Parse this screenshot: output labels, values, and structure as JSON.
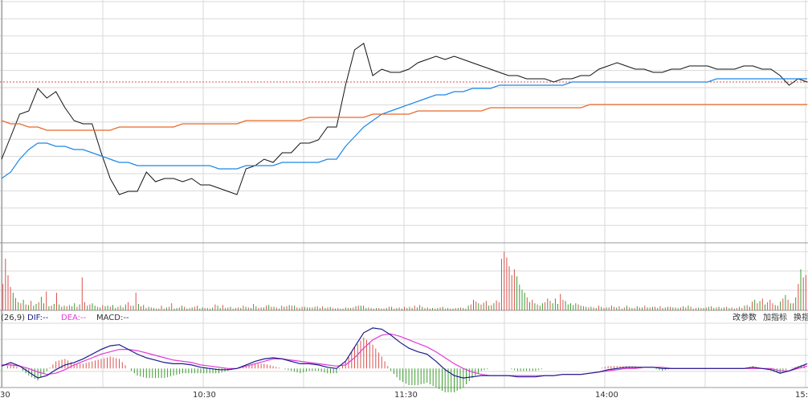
{
  "chart_data": [
    {
      "type": "line",
      "panel": "intraday-price",
      "grid": true,
      "series": [
        {
          "color": "#111111",
          "values": [
            126,
            133,
            140,
            141,
            148,
            145,
            147,
            142,
            138,
            137,
            137,
            128,
            120,
            115,
            116,
            116,
            122,
            119,
            120,
            120,
            119,
            120,
            118,
            118,
            117,
            116,
            115,
            123,
            124,
            126,
            125,
            128,
            128,
            131,
            131,
            132,
            136,
            136,
            149,
            160,
            162,
            152,
            154,
            153,
            153,
            154,
            156,
            157,
            158,
            157,
            158,
            157,
            156,
            155,
            154,
            153,
            152,
            152,
            151,
            151,
            151,
            150,
            151,
            151,
            152,
            152,
            154,
            155,
            156,
            155,
            154,
            154,
            153,
            153,
            154,
            154,
            155,
            155,
            155,
            154,
            154,
            154,
            155,
            155,
            154,
            154,
            152,
            149,
            151,
            150
          ]
        },
        {
          "color": "#1e88e5",
          "values": [
            120,
            122,
            126,
            129,
            131,
            131,
            130,
            130,
            129,
            129,
            128,
            127,
            126,
            125,
            125,
            124,
            124,
            124,
            124,
            124,
            124,
            124,
            124,
            124,
            123,
            123,
            123,
            124,
            124,
            124,
            124,
            125,
            125,
            125,
            125,
            125,
            126,
            126,
            130,
            133,
            136,
            138,
            140,
            141,
            142,
            143,
            144,
            145,
            146,
            146,
            147,
            147,
            148,
            148,
            148,
            149,
            149,
            149,
            149,
            149,
            149,
            149,
            149,
            150,
            150,
            150,
            150,
            150,
            150,
            150,
            150,
            150,
            150,
            150,
            150,
            150,
            150,
            150,
            150,
            151,
            151,
            151,
            151,
            151,
            151,
            151,
            151,
            151,
            151,
            151
          ]
        },
        {
          "color": "#e8692a",
          "values": [
            138,
            137,
            137,
            136,
            136,
            135,
            135,
            135,
            135,
            135,
            135,
            135,
            135,
            136,
            136,
            136,
            136,
            136,
            136,
            136,
            137,
            137,
            137,
            137,
            137,
            137,
            137,
            138,
            138,
            138,
            138,
            138,
            138,
            138,
            139,
            139,
            139,
            139,
            139,
            139,
            139,
            140,
            140,
            140,
            140,
            140,
            141,
            141,
            141,
            141,
            141,
            141,
            141,
            141,
            142,
            142,
            142,
            142,
            142,
            142,
            142,
            142,
            142,
            142,
            142,
            143,
            143,
            143,
            143,
            143,
            143,
            143,
            143,
            143,
            143,
            143,
            143,
            143,
            143,
            143,
            143,
            143,
            143,
            143,
            143,
            143,
            143,
            143,
            143,
            143
          ]
        }
      ],
      "reference_level": 150,
      "reference_color": "#d9534f"
    },
    {
      "type": "bar",
      "panel": "volume",
      "grid": true,
      "up_color": "#d9534f",
      "down_color": "#3d9c2f",
      "values": [
        45,
        88,
        60,
        40,
        30,
        21,
        14,
        12,
        18,
        10,
        9,
        16,
        8,
        11,
        14,
        23,
        12,
        32,
        7,
        8,
        11,
        30,
        10,
        6,
        8,
        7,
        9,
        7,
        12,
        6,
        10,
        56,
        14,
        8,
        10,
        12,
        8,
        6,
        5,
        9,
        7,
        8,
        6,
        9,
        4,
        6,
        8,
        5,
        10,
        14,
        8,
        8,
        30,
        11,
        7,
        9,
        4,
        6,
        5,
        4,
        3,
        3,
        8,
        3,
        5,
        6,
        12,
        3,
        4,
        5,
        8,
        6,
        3,
        4,
        5,
        6,
        8,
        3,
        5,
        4,
        4,
        3,
        5,
        10,
        8,
        4,
        9,
        4,
        5,
        6,
        3,
        4,
        5,
        4,
        8,
        6,
        5,
        4,
        11,
        7,
        4,
        5,
        5,
        8,
        9,
        6,
        6,
        5,
        3,
        8,
        6,
        7,
        9,
        8,
        8,
        5,
        4,
        6,
        6,
        5,
        5,
        5,
        6,
        7,
        4,
        7,
        4,
        5,
        6,
        4,
        3,
        4,
        3,
        3,
        5,
        4,
        4,
        5,
        7,
        8,
        8,
        8,
        4,
        5,
        4,
        3,
        4,
        4,
        3,
        3,
        4,
        6,
        6,
        3,
        4,
        5,
        3,
        6,
        4,
        6,
        4,
        8,
        5,
        9,
        6,
        4,
        5,
        3,
        4,
        3,
        4,
        5,
        6,
        3,
        4,
        3,
        3,
        4,
        4,
        5,
        4,
        3,
        8,
        10,
        18,
        15,
        12,
        10,
        13,
        16,
        8,
        9,
        12,
        17,
        14,
        88,
        100,
        90,
        75,
        60,
        70,
        58,
        44,
        35,
        30,
        22,
        14,
        18,
        12,
        10,
        8,
        12,
        14,
        20,
        16,
        12,
        20,
        11,
        28,
        18,
        16,
        10,
        12,
        9,
        12,
        10,
        8,
        7,
        6,
        5,
        6,
        5,
        4,
        8,
        6,
        4,
        5,
        5,
        8,
        6,
        5,
        7,
        3,
        5,
        8,
        5,
        4,
        4,
        7,
        5,
        5,
        8,
        5,
        5,
        6,
        6,
        4,
        7,
        4,
        5,
        6,
        6,
        5,
        5,
        4,
        5,
        7,
        5,
        8,
        6,
        3,
        4,
        5,
        4,
        4,
        5,
        6,
        7,
        4,
        5,
        6,
        4,
        5,
        6,
        4,
        5,
        3,
        4,
        6,
        4,
        8,
        9,
        6,
        15,
        18,
        12,
        16,
        20,
        10,
        14,
        18,
        12,
        9,
        8,
        15,
        20,
        26,
        18,
        12,
        12,
        22,
        45,
        70,
        56,
        60
      ],
      "up": [
        1,
        1,
        1,
        1,
        0,
        1,
        0,
        1,
        0,
        1,
        0,
        1,
        0,
        0,
        1,
        0,
        0,
        1,
        0,
        1,
        0,
        1,
        0,
        1,
        0,
        1,
        1,
        0,
        0,
        1,
        0,
        1,
        1,
        0,
        1,
        0,
        0,
        1,
        0,
        1,
        0,
        0,
        1,
        0,
        0,
        1,
        0,
        1,
        0,
        1,
        1,
        0,
        1,
        0,
        1,
        0,
        1,
        0,
        1,
        0,
        1,
        0,
        1,
        1,
        0,
        1,
        1,
        0,
        0,
        1,
        0,
        1,
        0,
        1,
        0,
        1,
        1,
        0,
        0,
        1,
        0,
        1,
        0,
        1,
        0,
        0,
        1,
        0,
        1,
        0,
        1,
        0,
        1,
        0,
        1,
        0,
        1,
        0,
        1,
        0,
        1,
        1,
        0,
        1,
        0,
        1,
        0,
        1,
        0,
        1,
        0,
        1,
        0,
        1,
        0,
        1,
        0,
        1,
        0,
        1,
        0,
        1,
        0,
        1,
        0,
        1,
        0,
        1,
        0,
        1,
        0,
        1,
        0,
        1,
        0,
        1,
        0,
        1,
        0,
        1,
        0,
        1,
        0,
        1,
        0,
        1,
        0,
        1,
        0,
        1,
        0,
        1,
        0,
        1,
        0,
        1,
        0,
        1,
        0,
        1,
        0,
        1,
        0,
        1,
        0,
        1,
        0,
        1,
        0,
        1,
        0,
        1,
        0,
        1,
        0,
        1,
        0,
        1,
        0,
        1,
        0,
        1,
        0,
        1,
        0,
        1,
        0,
        1,
        0,
        1,
        0,
        1,
        0,
        1,
        1,
        1,
        1,
        1,
        1,
        1,
        1,
        0,
        0,
        0,
        0,
        1,
        0,
        1,
        0,
        1,
        0,
        0,
        1,
        0,
        1,
        0,
        0,
        0,
        1,
        1,
        0,
        0,
        0,
        0,
        0,
        1,
        0,
        1,
        0,
        1,
        0,
        1,
        0,
        1,
        0,
        1,
        0,
        1,
        0,
        1,
        0,
        1,
        0,
        1,
        0,
        1,
        0,
        1,
        0,
        1,
        0,
        1,
        0,
        1,
        0,
        1,
        0,
        1,
        0,
        1,
        0,
        1,
        0,
        1,
        0,
        1,
        0,
        1,
        0,
        1,
        0,
        1,
        0,
        1,
        0,
        1,
        0,
        1,
        0,
        1,
        0,
        1,
        0,
        1,
        0,
        1,
        0,
        1,
        0,
        1,
        0,
        1,
        0,
        1,
        0,
        1,
        0,
        1,
        0,
        1,
        1,
        1,
        0,
        1,
        0,
        1,
        0,
        1,
        0,
        1,
        0,
        1,
        0,
        1,
        1,
        1,
        1,
        1,
        1,
        0,
        1,
        1,
        0,
        1
      ]
    },
    {
      "type": "line",
      "panel": "macd",
      "grid": true,
      "legend": {
        "params": "(26,9)",
        "dif": "DIF:--",
        "dea": "DEA:--",
        "macd": "MACD:--"
      },
      "dif_color": "#1a1a8c",
      "dea_color": "#e23ad8",
      "series": [
        {
          "name": "DIF",
          "values": [
            0.2,
            0.5,
            0.2,
            -0.3,
            -0.8,
            -0.6,
            -0.1,
            0.3,
            0.5,
            0.8,
            1.2,
            1.6,
            1.9,
            2.0,
            1.6,
            1.2,
            0.9,
            0.7,
            0.5,
            0.4,
            0.4,
            0.3,
            0.1,
            0.0,
            -0.1,
            -0.1,
            0.0,
            0.3,
            0.6,
            0.8,
            0.9,
            0.8,
            0.6,
            0.4,
            0.4,
            0.3,
            0.1,
            0.0,
            0.6,
            1.8,
            3.0,
            3.4,
            3.3,
            2.8,
            2.2,
            1.7,
            1.4,
            1.2,
            0.6,
            -0.1,
            -0.6,
            -0.8,
            -0.7,
            -0.6,
            -0.6,
            -0.6,
            -0.6,
            -0.7,
            -0.7,
            -0.7,
            -0.6,
            -0.6,
            -0.5,
            -0.5,
            -0.5,
            -0.4,
            -0.3,
            -0.1,
            0.0,
            0.1,
            0.1,
            0.1,
            0.1,
            0.0,
            0.0,
            0.0,
            0.0,
            0.0,
            0.0,
            0.0,
            0.0,
            0.0,
            0.0,
            0.1,
            0.0,
            -0.1,
            -0.4,
            -0.2,
            0.1,
            0.4
          ]
        },
        {
          "name": "DEA",
          "values": [
            0.3,
            0.3,
            0.2,
            0.0,
            -0.3,
            -0.5,
            -0.4,
            -0.1,
            0.3,
            0.6,
            0.9,
            1.2,
            1.4,
            1.6,
            1.6,
            1.5,
            1.3,
            1.1,
            0.9,
            0.7,
            0.6,
            0.5,
            0.3,
            0.2,
            0.1,
            0.0,
            0.0,
            0.2,
            0.4,
            0.6,
            0.8,
            0.8,
            0.7,
            0.6,
            0.5,
            0.4,
            0.3,
            0.2,
            0.3,
            0.9,
            1.7,
            2.4,
            2.8,
            2.9,
            2.7,
            2.4,
            2.1,
            1.8,
            1.4,
            0.9,
            0.4,
            0.0,
            -0.3,
            -0.5,
            -0.6,
            -0.6,
            -0.6,
            -0.6,
            -0.6,
            -0.6,
            -0.6,
            -0.6,
            -0.5,
            -0.5,
            -0.5,
            -0.4,
            -0.3,
            -0.2,
            -0.1,
            0.0,
            0.0,
            0.1,
            0.1,
            0.1,
            0.0,
            0.0,
            0.0,
            0.0,
            0.0,
            0.0,
            0.0,
            0.0,
            0.0,
            0.0,
            0.0,
            0.0,
            -0.2,
            -0.2,
            0.0,
            0.2
          ]
        }
      ]
    }
  ],
  "toolbar": {
    "change_params": "改参数",
    "add_indicator": "加指标",
    "switch": "换指"
  },
  "time_axis": [
    "30",
    "10:30",
    "11:30",
    "14:00",
    "15:"
  ]
}
